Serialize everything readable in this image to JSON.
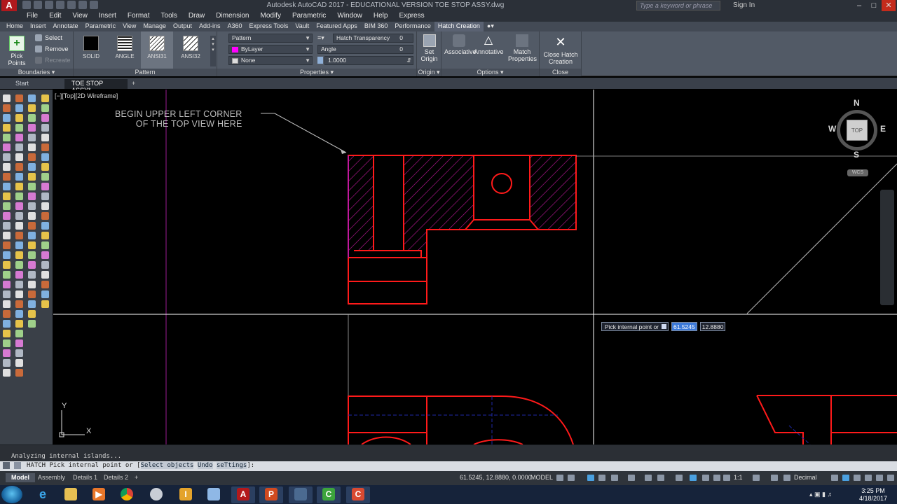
{
  "app": {
    "window_title": "Autodesk AutoCAD 2017 - EDUCATIONAL VERSION    TOE STOP ASSY.dwg",
    "logo_letter": "A",
    "search_placeholder": "Type a keyword or phrase",
    "sign_in": "Sign In"
  },
  "menu": [
    "File",
    "Edit",
    "View",
    "Insert",
    "Format",
    "Tools",
    "Draw",
    "Dimension",
    "Modify",
    "Parametric",
    "Window",
    "Help",
    "Express"
  ],
  "ribbon_tabs": [
    "Home",
    "Insert",
    "Annotate",
    "Parametric",
    "View",
    "Manage",
    "Output",
    "Add-ins",
    "A360",
    "Express Tools",
    "Vault",
    "Featured Apps",
    "BIM 360",
    "Performance",
    "Hatch Creation"
  ],
  "ribbon": {
    "boundaries": {
      "title": "Boundaries",
      "pick_points": "Pick Points",
      "select": "Select",
      "remove": "Remove",
      "recreate": "Recreate"
    },
    "pattern": {
      "title": "Pattern",
      "swatches": [
        "SOLID",
        "ANGLE",
        "ANSI31",
        "ANSI32"
      ]
    },
    "properties": {
      "title": "Properties",
      "type": "Pattern",
      "color": "ByLayer",
      "background": "None",
      "transparency_label": "Hatch Transparency",
      "transparency_value": "0",
      "angle_label": "Angle",
      "angle_value": "0",
      "scale_value": "1.0000"
    },
    "origin": {
      "title": "Origin",
      "set_origin": "Set Origin"
    },
    "options": {
      "title": "Options",
      "associative": "Associative",
      "annotative": "Annotative",
      "match_properties": "Match Properties"
    },
    "close": {
      "title": "Close",
      "close_hatch": "Close Hatch Creation"
    }
  },
  "file_tabs": [
    "Start",
    "TOE STOP ASSY*"
  ],
  "viewport": {
    "label": "[−][Top][2D Wireframe]",
    "annotation_line1": "BEGIN UPPER LEFT CORNER",
    "annotation_line2": "OF THE TOP VIEW HERE"
  },
  "viewcube": {
    "north": "N",
    "south": "S",
    "east": "E",
    "west": "W",
    "face": "TOP",
    "wcs": "WCS"
  },
  "dynamic_input": {
    "prompt": "Pick internal point or",
    "x_value": "61.5245",
    "y_value": "12.8880"
  },
  "ucs": {
    "x": "X",
    "y": "Y"
  },
  "command": {
    "history": "Analyzing internal islands...",
    "prompt_prefix": "HATCH Pick internal point or [",
    "opt_select": "Select objects",
    "opt_undo": "Undo",
    "opt_settings": "seTtings",
    "prompt_suffix": "]:"
  },
  "layout_tabs": [
    "Model",
    "Assembly",
    "Details 1",
    "Details 2"
  ],
  "status": {
    "coords": "61.5245, 12.8880, 0.0000",
    "model": "MODEL",
    "scale": "1:1",
    "units": "Decimal"
  },
  "clock": {
    "time": "3:25 PM",
    "date": "4/18/2017"
  },
  "colors": {
    "drawing_red": "#ff1a1a",
    "hatch_magenta": "#c2189c",
    "crosshair": "#ffffff",
    "accent_blue": "#3a78d8"
  }
}
